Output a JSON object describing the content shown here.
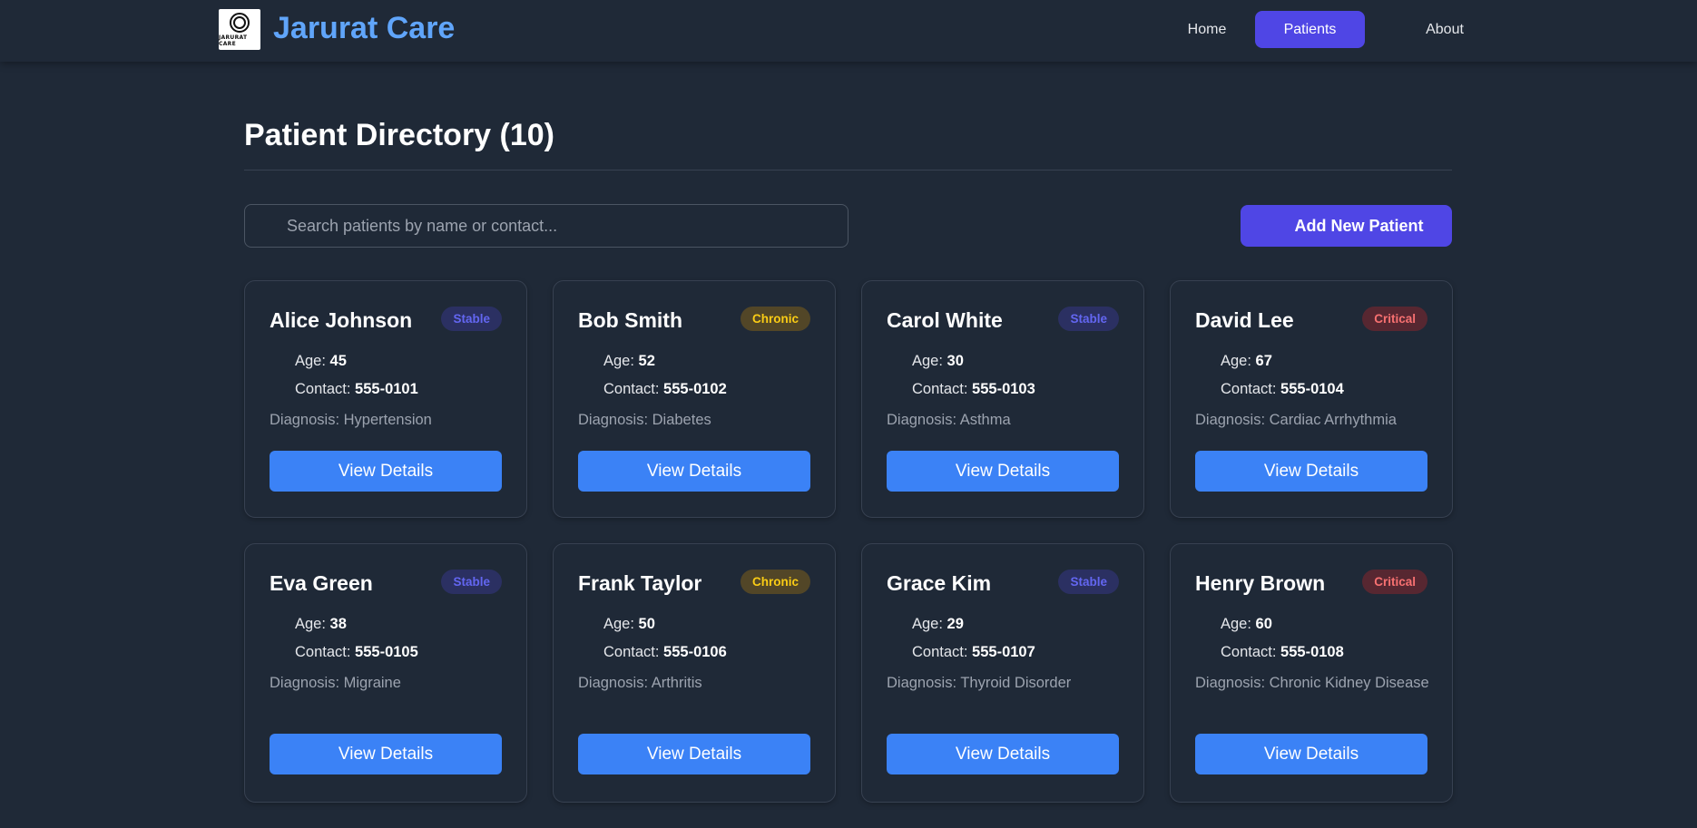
{
  "brand": {
    "logo_text": "JARURAT CARE",
    "name": "Jarurat Care"
  },
  "nav": {
    "home": "Home",
    "patients": "Patients",
    "about": "About",
    "active": "Patients"
  },
  "page": {
    "title": "Patient Directory (10)"
  },
  "search": {
    "placeholder": "Search patients by name or contact...",
    "value": ""
  },
  "actions": {
    "add_label": "Add New Patient"
  },
  "labels": {
    "age": "Age: ",
    "contact": "Contact: ",
    "diagnosis_prefix": "Diagnosis: ",
    "view": "View Details"
  },
  "colors": {
    "background": "#1f2937",
    "brand": "#60a5fa",
    "accent": "#4f46e5",
    "button": "#3b82f6",
    "stable": "#6366f1",
    "chronic": "#facc15",
    "critical": "#f87171"
  },
  "patients": [
    {
      "name": "Alice Johnson",
      "status": "Stable",
      "age": "45",
      "contact": "555-0101",
      "diagnosis": "Diagnosis: Hypertension"
    },
    {
      "name": "Bob Smith",
      "status": "Chronic",
      "age": "52",
      "contact": "555-0102",
      "diagnosis": "Diagnosis: Diabetes"
    },
    {
      "name": "Carol White",
      "status": "Stable",
      "age": "30",
      "contact": "555-0103",
      "diagnosis": "Diagnosis: Asthma"
    },
    {
      "name": "David Lee",
      "status": "Critical",
      "age": "67",
      "contact": "555-0104",
      "diagnosis": "Diagnosis: Cardiac Arrhythmia"
    },
    {
      "name": "Eva Green",
      "status": "Stable",
      "age": "38",
      "contact": "555-0105",
      "diagnosis": "Diagnosis: Migraine"
    },
    {
      "name": "Frank Taylor",
      "status": "Chronic",
      "age": "50",
      "contact": "555-0106",
      "diagnosis": "Diagnosis: Arthritis"
    },
    {
      "name": "Grace Kim",
      "status": "Stable",
      "age": "29",
      "contact": "555-0107",
      "diagnosis": "Diagnosis: Thyroid Disorder"
    },
    {
      "name": "Henry Brown",
      "status": "Critical",
      "age": "60",
      "contact": "555-0108",
      "diagnosis": "Diagnosis: Chronic Kidney Disease"
    }
  ]
}
